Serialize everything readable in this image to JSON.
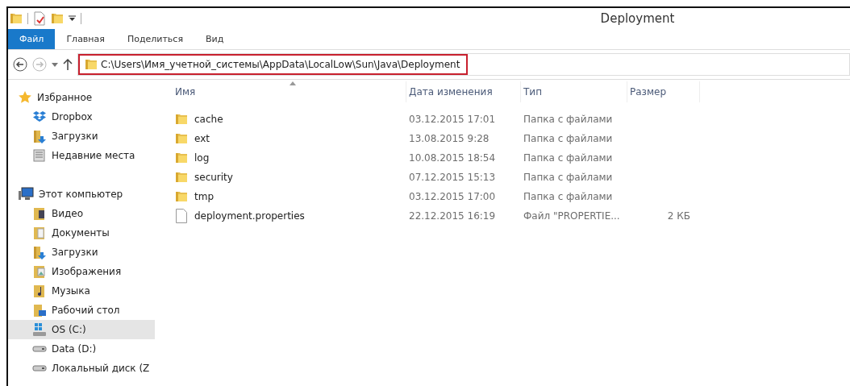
{
  "window": {
    "title": "Deployment"
  },
  "ribbon_tabs": [
    {
      "label": "Файл",
      "selected": true
    },
    {
      "label": "Главная",
      "selected": false
    },
    {
      "label": "Поделиться",
      "selected": false
    },
    {
      "label": "Вид",
      "selected": false
    }
  ],
  "address_bar": {
    "path": "C:\\Users\\Имя_учетной_системы\\AppData\\LocalLow\\Sun\\Java\\Deployment",
    "highlighted": true
  },
  "sidebar": {
    "groups": [
      {
        "label": "Избранное",
        "kind": "star",
        "items": [
          {
            "label": "Dropbox",
            "kind": "dropbox",
            "selected": false
          },
          {
            "label": "Загрузки",
            "kind": "downloads",
            "selected": false
          },
          {
            "label": "Недавние места",
            "kind": "recent",
            "selected": false
          }
        ]
      },
      {
        "label": "Этот компьютер",
        "kind": "computer",
        "items": [
          {
            "label": "Видео",
            "kind": "video",
            "selected": false
          },
          {
            "label": "Документы",
            "kind": "documents",
            "selected": false
          },
          {
            "label": "Загрузки",
            "kind": "downloads",
            "selected": false
          },
          {
            "label": "Изображения",
            "kind": "pictures",
            "selected": false
          },
          {
            "label": "Музыка",
            "kind": "music",
            "selected": false
          },
          {
            "label": "Рабочий стол",
            "kind": "desktop",
            "selected": false
          },
          {
            "label": "OS (C:)",
            "kind": "system-drive",
            "selected": true
          },
          {
            "label": "Data (D:)",
            "kind": "drive",
            "selected": false
          },
          {
            "label": "Локальный диск (Z",
            "kind": "drive",
            "selected": false
          }
        ]
      }
    ]
  },
  "table": {
    "columns": [
      {
        "label": "Имя",
        "sorted": true
      },
      {
        "label": "Дата изменения",
        "sorted": false
      },
      {
        "label": "Тип",
        "sorted": false
      },
      {
        "label": "Размер",
        "sorted": false
      }
    ],
    "rows": [
      {
        "kind": "folder",
        "name": "cache",
        "modified": "03.12.2015 17:01",
        "type": "Папка с файлами"
      },
      {
        "kind": "folder",
        "name": "ext",
        "modified": "13.08.2015 9:28",
        "type": "Папка с файлами"
      },
      {
        "kind": "folder",
        "name": "log",
        "modified": "10.08.2015 18:54",
        "type": "Папка с файлами"
      },
      {
        "kind": "folder",
        "name": "security",
        "modified": "07.12.2015 15:13",
        "type": "Папка с файлами"
      },
      {
        "kind": "folder",
        "name": "tmp",
        "modified": "03.12.2015 17:00",
        "type": "Папка с файлами"
      },
      {
        "kind": "file",
        "name": "deployment.properties",
        "modified": "22.12.2015 16:19",
        "type": "Файл \"PROPERTIE...",
        "size": "2 КБ"
      }
    ]
  }
}
